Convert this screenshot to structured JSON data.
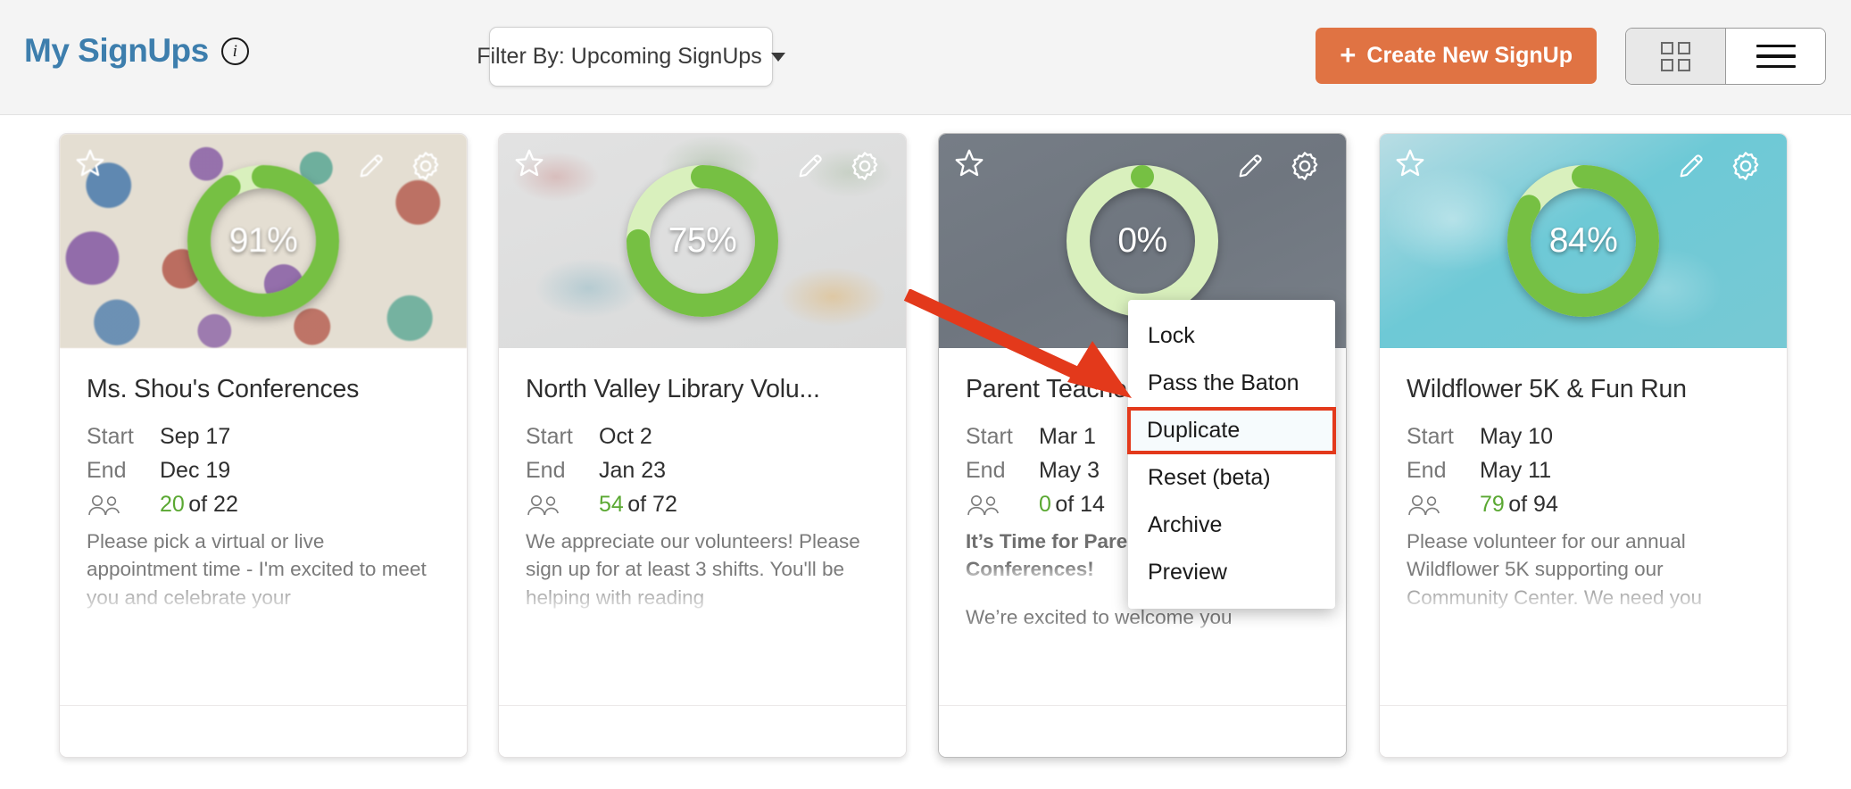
{
  "header": {
    "title": "My SignUps",
    "info_icon": "info-icon",
    "filter": {
      "label": "Filter By: Upcoming SignUps",
      "caret": "chevron-down-icon"
    },
    "create_button": {
      "label": "Create New SignUp",
      "plus": "+",
      "color": "#e07343"
    },
    "view_toggle": {
      "grid_label": "grid-view-icon",
      "list_label": "list-view-icon",
      "selected": "list"
    }
  },
  "labels": {
    "start": "Start",
    "end": "End",
    "of": "of",
    "people_icon": "people-icon"
  },
  "cards": [
    {
      "title": "Ms. Shou's Conferences",
      "percent": "91%",
      "percent_value": 91,
      "start": "Sep 17",
      "end": "Dec 19",
      "filled": "20",
      "total": "of 22",
      "description": "Please pick a virtual or live appointment time - I'm excited to meet you and celebrate your",
      "bold_description": false,
      "hero_style": "handprints"
    },
    {
      "title": "North Valley Library Volu...",
      "percent": "75%",
      "percent_value": 75,
      "start": "Oct 2",
      "end": "Jan 23",
      "filled": "54",
      "total": "of 72",
      "description": "We appreciate our volunteers! Please sign up for at least 3 shifts. You'll be helping with reading",
      "bold_description": false,
      "hero_style": "books"
    },
    {
      "title": "Parent Teacher Conferences",
      "percent": "0%",
      "percent_value": 0,
      "start": "Mar 1",
      "end": "May 3",
      "filled": "0",
      "total": "of 14",
      "description": "It’s Time for Parent-Teacher Conferences!",
      "description2": "We’re excited to welcome you",
      "bold_description": true,
      "hero_style": "slate"
    },
    {
      "title": "Wildflower 5K & Fun Run",
      "percent": "84%",
      "percent_value": 84,
      "start": "May 10",
      "end": "May 11",
      "filled": "79",
      "total": "of 94",
      "description": "Please volunteer for our annual Wildflower 5K supporting our Community Center. We need you",
      "bold_description": false,
      "hero_style": "aqua"
    }
  ],
  "card_icons": {
    "star": "star-icon",
    "pencil": "pencil-icon",
    "gear": "gear-icon"
  },
  "context_menu": {
    "items": [
      {
        "label": "Lock",
        "highlighted": false
      },
      {
        "label": "Pass the Baton",
        "highlighted": false
      },
      {
        "label": "Duplicate",
        "highlighted": true
      },
      {
        "label": "Reset (beta)",
        "highlighted": false
      },
      {
        "label": "Archive",
        "highlighted": false
      },
      {
        "label": "Preview",
        "highlighted": false
      }
    ]
  },
  "annotation": {
    "arrow_color": "#e3391b",
    "points_to": "Duplicate"
  },
  "colors": {
    "brand_blue": "#3d7ead",
    "accent_orange": "#e07343",
    "donut_green": "#76c043",
    "donut_track": "#d9f0bd",
    "count_green": "#5aa832",
    "annotation_red": "#e3391b"
  }
}
